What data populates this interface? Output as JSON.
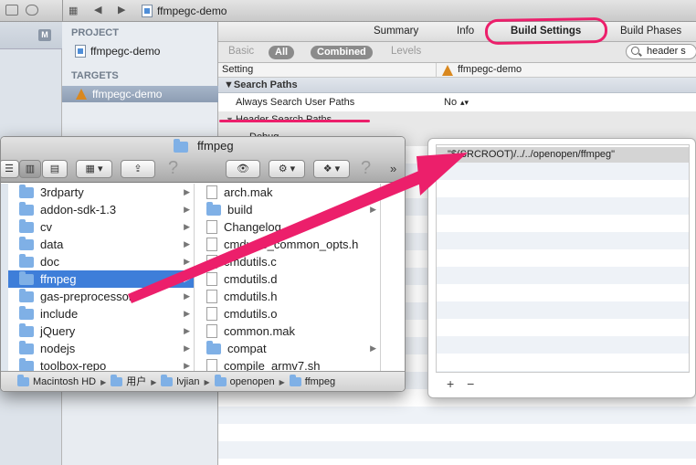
{
  "window": {
    "title": "ffmpegc-demo"
  },
  "project_navigator": {
    "project_header": "PROJECT",
    "project_item": "ffmpegc-demo",
    "targets_header": "TARGETS",
    "target_item": "ffmpegc-demo",
    "left_badge": "M"
  },
  "editor": {
    "tabs": [
      "Summary",
      "Info",
      "Build Settings",
      "Build Phases"
    ],
    "selected_tab": "Build Settings",
    "filters": {
      "basic": "Basic",
      "all": "All",
      "combined": "Combined",
      "levels": "Levels"
    },
    "search_value": "header s",
    "column_setting": "Setting",
    "column_target": "ffmpegc-demo",
    "group_search_paths": "Search Paths",
    "row_always_search_label": "Always Search User Paths",
    "row_always_search_value": "No",
    "row_header_search_label": "Header Search Paths",
    "row_debug_label": "Debug"
  },
  "popover": {
    "entry": "\"$(SRCROOT)/../../openopen/ffmpeg\"",
    "add": "+",
    "remove": "−"
  },
  "finder": {
    "title": "ffmpeg",
    "left_column": [
      "3rdparty",
      "addon-sdk-1.3",
      "cv",
      "data",
      "doc",
      "ffmpeg",
      "gas-preprocessor",
      "include",
      "jQuery",
      "nodejs",
      "toolbox-repo"
    ],
    "selected": "ffmpeg",
    "right_column": [
      "arch.mak",
      "build",
      "Changelog",
      "cmdutils_common_opts.h",
      "cmdutils.c",
      "cmdutils.d",
      "cmdutils.h",
      "cmdutils.o",
      "common.mak",
      "compat",
      "compile_armv7.sh"
    ],
    "path": [
      "Macintosh HD",
      "用户",
      "lvjian",
      "openopen",
      "ffmpeg"
    ]
  },
  "colors": {
    "annotation": "#ec1f6b",
    "selection": "#3e7ed9"
  }
}
